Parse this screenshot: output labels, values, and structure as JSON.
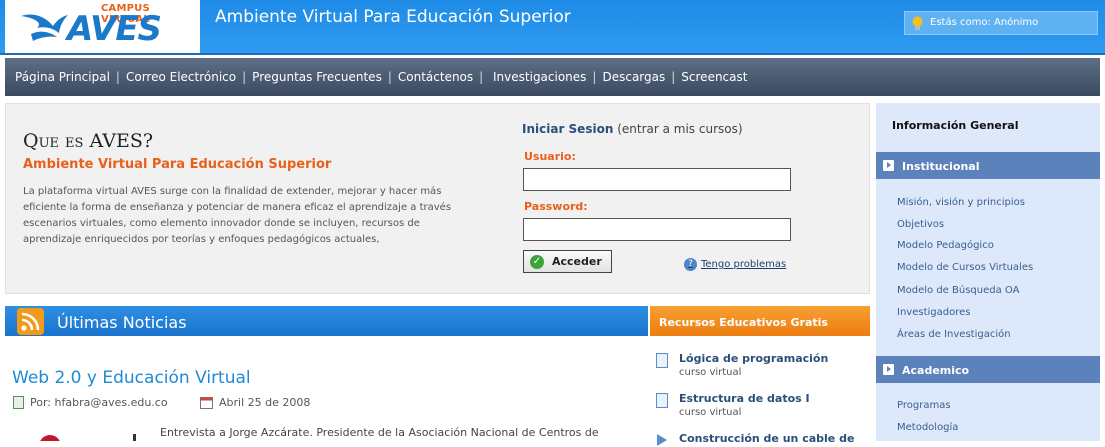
{
  "header": {
    "logo_campus": "CAMPUS VIRTUAL",
    "logo_name": "AVES",
    "site_title": "Ambiente Virtual Para Educación Superior",
    "user_status": "Estás como:  Anónimo",
    "colors": {
      "header_blue": "#2f9af0",
      "brand_orange": "#e9601a",
      "nav_slate": "#4a5a72"
    }
  },
  "nav": {
    "items": [
      "Página Principal",
      "Correo Electrónico",
      "Preguntas Frecuentes",
      "Contáctenos",
      " Investigaciones",
      "Descargas",
      "Screencast"
    ]
  },
  "intro": {
    "title": "Que es AVES?",
    "subtitle": "Ambiente Virtual Para Educación Superior",
    "body": "La plataforma virtual AVES surge con la finalidad de extender, mejorar y hacer más eficiente la forma de enseñanza y potenciar de manera eficaz el aprendizaje a través escenarios virtuales, como elemento innovador donde se incluyen, recursos de aprendizaje enriquecidos por teorías y enfoques pedagógicos actuales,"
  },
  "login": {
    "title": "Iniciar Sesion",
    "title_note": "(entrar a mis cursos)",
    "user_label": "Usuario:",
    "user_value": "",
    "password_label": "Password:",
    "password_value": "",
    "submit_label": "Acceder",
    "help_link": "Tengo problemas"
  },
  "news": {
    "heading": "Últimas Noticias",
    "article_title": "Web 2.0 y Educación Virtual",
    "author": "Por: hfabra@aves.edu.co",
    "date": "Abril 25 de 2008",
    "excerpt": "Entrevista a Jorge Azcárate. Presidente de la Asociación Nacional de Centros de"
  },
  "resources": {
    "heading": "Recursos Educativos Gratis",
    "items": [
      {
        "name": "Lógica de programación",
        "type": "curso virtual"
      },
      {
        "name": "Estructura de datos I",
        "type": "curso virtual"
      },
      {
        "name": "Construcción de un cable de",
        "type": ""
      }
    ]
  },
  "sidebar": {
    "heading": "Información General",
    "sections": [
      {
        "title": "Institucional",
        "links": [
          "Misión, visión y principios",
          "Objetivos",
          "Modelo Pedagógico",
          "Modelo de Cursos Virtuales",
          "Modelo de Búsqueda OA",
          "Investigadores",
          "Áreas de Investigación"
        ]
      },
      {
        "title": "Academico",
        "links": [
          "Programas",
          "Metodología"
        ]
      }
    ]
  }
}
